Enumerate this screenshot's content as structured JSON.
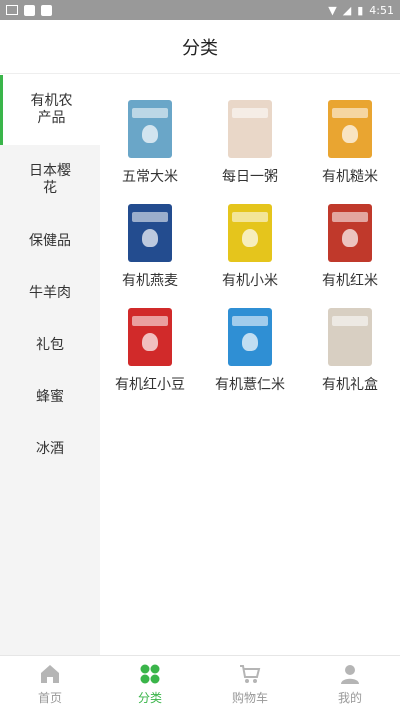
{
  "status": {
    "time": "4:51"
  },
  "header": {
    "title": "分类"
  },
  "sidebar": {
    "items": [
      {
        "label": "有机农产品"
      },
      {
        "label": "日本樱花"
      },
      {
        "label": "保健品"
      },
      {
        "label": "牛羊肉"
      },
      {
        "label": "礼包"
      },
      {
        "label": "蜂蜜"
      },
      {
        "label": "冰酒"
      }
    ]
  },
  "products": [
    {
      "name": "五常大米",
      "color": "#6aa6c8"
    },
    {
      "name": "每日一粥",
      "color": "#e9d7c8"
    },
    {
      "name": "有机糙米",
      "color": "#e9a531"
    },
    {
      "name": "有机燕麦",
      "color": "#234c8f"
    },
    {
      "name": "有机小米",
      "color": "#e5c51c"
    },
    {
      "name": "有机红米",
      "color": "#c0392b"
    },
    {
      "name": "有机红小豆",
      "color": "#d12a2a"
    },
    {
      "name": "有机薏仁米",
      "color": "#2f8fd4"
    },
    {
      "name": "有机礼盒",
      "color": "#d8cfc2"
    }
  ],
  "tabbar": {
    "home": "首页",
    "category": "分类",
    "cart": "购物车",
    "mine": "我的",
    "accent": "#3ab54a"
  }
}
